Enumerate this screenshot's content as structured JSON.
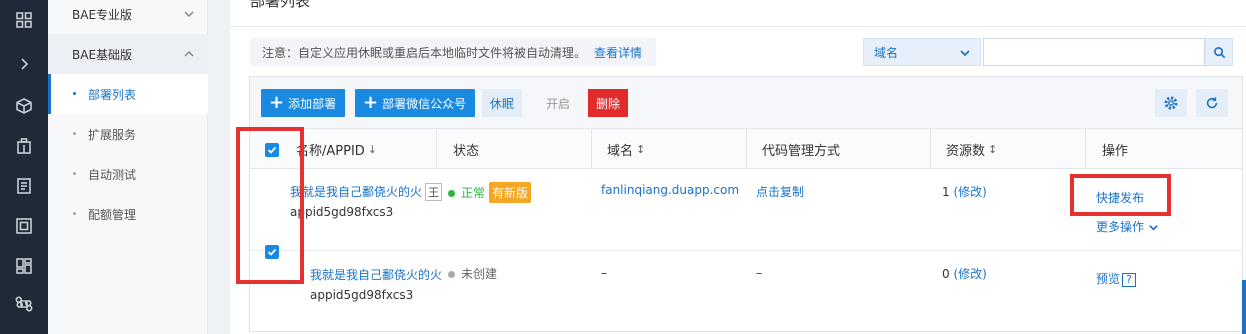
{
  "sidebar": {
    "groups": [
      {
        "label": "BAE专业版"
      },
      {
        "label": "BAE基础版"
      }
    ],
    "items": [
      {
        "label": "部署列表"
      },
      {
        "label": "扩展服务"
      },
      {
        "label": "自动测试"
      },
      {
        "label": "配额管理"
      }
    ]
  },
  "main": {
    "title": "部署列表",
    "notice": {
      "text": "注意：自定义应用休眠或重启后本地临时文件将被自动清理。",
      "link": "查看详情"
    },
    "search": {
      "field_label": "域名",
      "value": ""
    }
  },
  "toolbar": {
    "add_deploy": "添加部署",
    "deploy_wechat": "部署微信公众号",
    "sleep": "休眠",
    "start": "开启",
    "delete": "删除"
  },
  "table": {
    "headers": {
      "name": "名称/APPID",
      "status": "状态",
      "domain": "域名",
      "code_mgmt": "代码管理方式",
      "resources": "资源数",
      "actions": "操作"
    },
    "sort_arrow": "↓",
    "sort_both": "↕",
    "rows": [
      {
        "name": "我就是我自己鄱侥火的火",
        "tag": "王",
        "appid": "appid5gd98fxcs3",
        "status": "正常",
        "badge": "有新版",
        "domain": "fanlinqiang.duapp.com",
        "code_mgmt": "点击复制",
        "resources": "1",
        "modify": "(修改)",
        "action_primary": "快捷发布",
        "action_more": "更多操作"
      },
      {
        "name": "我就是我自己鄱侥火的火",
        "appid": "appid5gd98fxcs3",
        "status": "未创建",
        "domain": "–",
        "code_mgmt": "–",
        "resources": "0",
        "modify": "(修改)",
        "action_primary": "预览",
        "help": "?"
      }
    ]
  },
  "colors": {
    "accent": "#1a8ae0",
    "danger": "#e42b2b",
    "ok": "#2fb344",
    "badge": "#f5a623",
    "highlight": "#e63131"
  }
}
